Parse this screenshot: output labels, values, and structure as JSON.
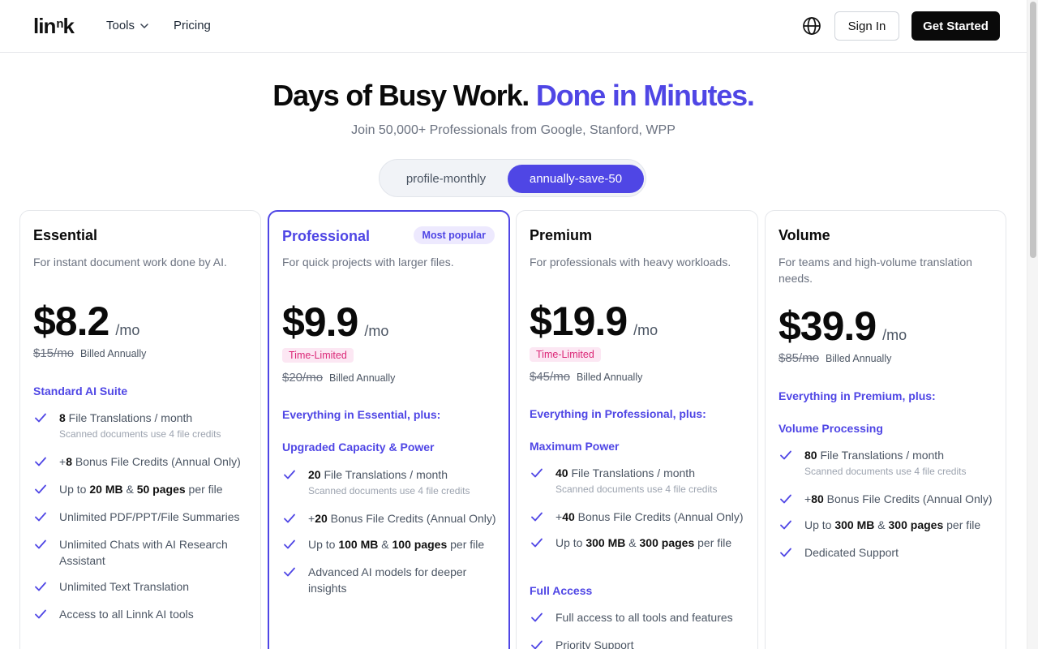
{
  "header": {
    "logo": "lin",
    "logo_sup": "n",
    "logo_tail": "k",
    "nav": {
      "tools": "Tools",
      "pricing": "Pricing"
    },
    "sign_in": "Sign In",
    "get_started": "Get Started"
  },
  "hero": {
    "title_a": "Days of Busy Work.",
    "title_b": "Done in Minutes.",
    "subtitle": "Join 50,000+ Professionals from Google, Stanford, WPP"
  },
  "billing_toggle": {
    "monthly": "profile-monthly",
    "annual": "annually-save-50",
    "selected": "annual"
  },
  "plans": [
    {
      "name": "Essential",
      "desc": "For instant document work done by AI.",
      "price": "$8.2",
      "per": "/mo",
      "old_price": "$15/mo",
      "billed": "Billed Annually",
      "section": "Standard AI Suite",
      "features": [
        {
          "pre": "",
          "b1": "8",
          "mid": " File Translations / month",
          "b2": "",
          "post": "",
          "sub": "Scanned documents use 4 file credits"
        },
        {
          "pre": "+",
          "b1": "8",
          "mid": " Bonus File Credits (Annual Only)",
          "b2": "",
          "post": "",
          "sub": ""
        },
        {
          "pre": "Up to ",
          "b1": "20 MB",
          "mid": " & ",
          "b2": "50 pages",
          "post": " per file",
          "sub": ""
        },
        {
          "pre": "Unlimited PDF/PPT/File Summaries",
          "b1": "",
          "mid": "",
          "b2": "",
          "post": "",
          "sub": ""
        },
        {
          "pre": "Unlimited Chats with AI Research Assistant",
          "b1": "",
          "mid": "",
          "b2": "",
          "post": "",
          "sub": ""
        },
        {
          "pre": "Unlimited Text Translation",
          "b1": "",
          "mid": "",
          "b2": "",
          "post": "",
          "sub": ""
        },
        {
          "pre": "Access to all Linnk AI tools",
          "b1": "",
          "mid": "",
          "b2": "",
          "post": "",
          "sub": ""
        }
      ]
    },
    {
      "name": "Professional",
      "badge": "Most popular",
      "desc": "For quick projects with larger files.",
      "price": "$9.9",
      "per": "/mo",
      "tag": "Time-Limited",
      "old_price": "$20/mo",
      "billed": "Billed Annually",
      "everything": "Everything in Essential, plus:",
      "section": "Upgraded Capacity & Power",
      "features": [
        {
          "pre": "",
          "b1": "20",
          "mid": " File Translations / month",
          "b2": "",
          "post": "",
          "sub": "Scanned documents use 4 file credits"
        },
        {
          "pre": "+",
          "b1": "20",
          "mid": " Bonus File Credits (Annual Only)",
          "b2": "",
          "post": "",
          "sub": ""
        },
        {
          "pre": "Up to ",
          "b1": "100 MB",
          "mid": " & ",
          "b2": "100 pages",
          "post": " per file",
          "sub": ""
        },
        {
          "pre": "Advanced AI models for deeper insights",
          "b1": "",
          "mid": "",
          "b2": "",
          "post": "",
          "sub": ""
        }
      ]
    },
    {
      "name": "Premium",
      "desc": "For professionals with heavy workloads.",
      "price": "$19.9",
      "per": "/mo",
      "tag": "Time-Limited",
      "old_price": "$45/mo",
      "billed": "Billed Annually",
      "everything": "Everything in Professional, plus:",
      "section": "Maximum Power",
      "features": [
        {
          "pre": "",
          "b1": "40",
          "mid": " File Translations / month",
          "b2": "",
          "post": "",
          "sub": "Scanned documents use 4 file credits"
        },
        {
          "pre": "+",
          "b1": "40",
          "mid": " Bonus File Credits (Annual Only)",
          "b2": "",
          "post": "",
          "sub": ""
        },
        {
          "pre": "Up to ",
          "b1": "300 MB",
          "mid": " & ",
          "b2": "300 pages",
          "post": " per file",
          "sub": ""
        }
      ],
      "section2": "Full Access",
      "features2": [
        {
          "pre": "Full access to all tools and features",
          "b1": "",
          "mid": "",
          "b2": "",
          "post": "",
          "sub": ""
        },
        {
          "pre": "Priority Support",
          "b1": "",
          "mid": "",
          "b2": "",
          "post": "",
          "sub": ""
        }
      ]
    },
    {
      "name": "Volume",
      "desc": "For teams and high-volume translation needs.",
      "price": "$39.9",
      "per": "/mo",
      "old_price": "$85/mo",
      "billed": "Billed Annually",
      "everything": "Everything in Premium, plus:",
      "section": "Volume Processing",
      "features": [
        {
          "pre": "",
          "b1": "80",
          "mid": " File Translations / month",
          "b2": "",
          "post": "",
          "sub": "Scanned documents use 4 file credits"
        },
        {
          "pre": "+",
          "b1": "80",
          "mid": " Bonus File Credits (Annual Only)",
          "b2": "",
          "post": "",
          "sub": ""
        },
        {
          "pre": "Up to ",
          "b1": "300 MB",
          "mid": " & ",
          "b2": "300 pages",
          "post": " per file",
          "sub": ""
        },
        {
          "pre": "Dedicated Support",
          "b1": "",
          "mid": "",
          "b2": "",
          "post": "",
          "sub": ""
        }
      ]
    }
  ],
  "colors": {
    "accent": "#4f46e5",
    "dark": "#0a0a0a",
    "tag": "#db2777",
    "badge_bg": "#ede9fe"
  },
  "icons": {
    "check": "check-icon",
    "globe": "globe-icon",
    "chevron": "chevron-down-icon"
  }
}
